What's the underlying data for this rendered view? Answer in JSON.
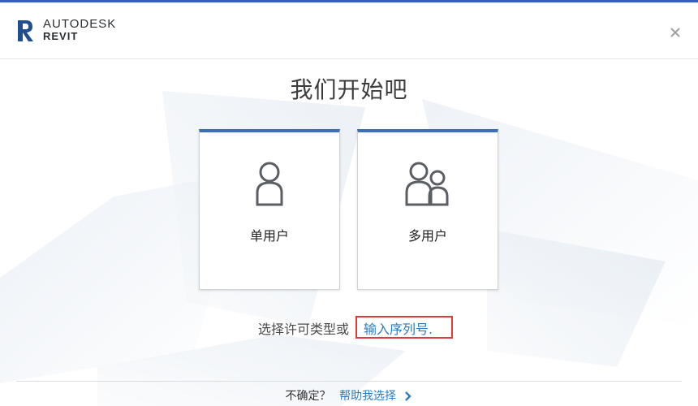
{
  "app": {
    "brand": "AUTODESK",
    "product": "REVIT",
    "accent_color": "#2f63b8"
  },
  "dialog": {
    "title": "我们开始吧",
    "license_prompt": "选择许可类型或",
    "serial_link": "输入序列号.",
    "cards": [
      {
        "label": "单用户",
        "icon": "single-user-icon"
      },
      {
        "label": "多用户",
        "icon": "multi-user-icon"
      }
    ]
  },
  "footer": {
    "question": "不确定？",
    "help_link": "帮助我选择"
  }
}
